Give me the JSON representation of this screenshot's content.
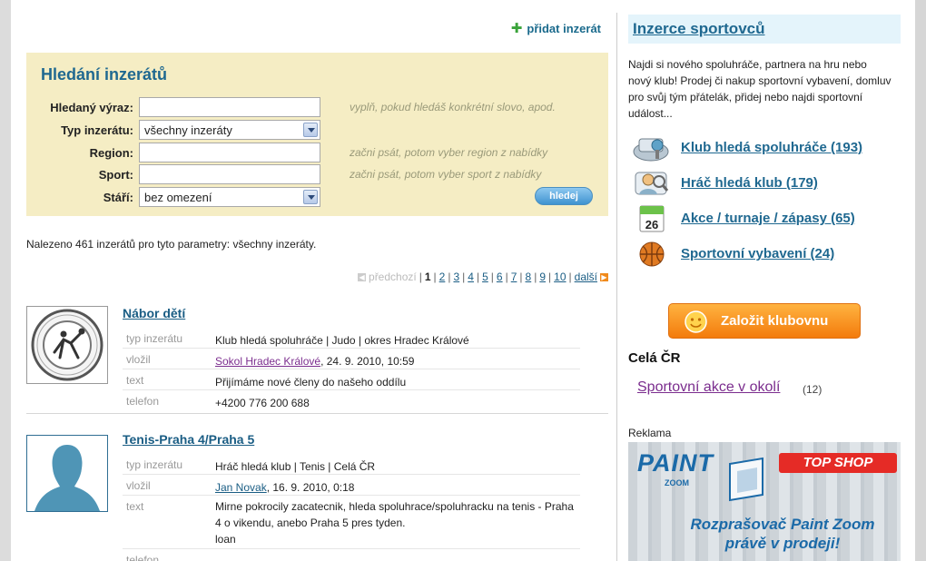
{
  "add_listing": "přidat inzerát",
  "search": {
    "title": "Hledání inzerátů",
    "fields": [
      {
        "label": "Hledaný výraz:",
        "value": "",
        "hint": "vyplň, pokud hledáš konkrétní slovo, apod."
      },
      {
        "label": "Typ inzerátu:",
        "value": "všechny inzeráty",
        "hint": ""
      },
      {
        "label": "Region:",
        "value": "",
        "hint": "začni psát, potom vyber region z nabídky"
      },
      {
        "label": "Sport:",
        "value": "",
        "hint": "začni psát, potom vyber sport z nabídky"
      },
      {
        "label": "Stáří:",
        "value": "bez omezení",
        "hint": ""
      }
    ],
    "button": "hledej"
  },
  "result_text": "Nalezeno 461 inzerátů pro tyto parametry: všechny inzeráty.",
  "pagination": {
    "prev": "předchozí",
    "current": "1",
    "pages": [
      "2",
      "3",
      "4",
      "5",
      "6",
      "7",
      "8",
      "9",
      "10"
    ],
    "next": "další",
    "separator": "|"
  },
  "listings": [
    {
      "title": "Nábor dětí",
      "rows": [
        {
          "key": "typ inzerátu",
          "value": "Klub hledá spoluhráče | Judo | okres Hradec Králové"
        },
        {
          "key": "vložil",
          "author": "Sokol Hradec Králové",
          "date": ", 24. 9. 2010, 10:59"
        },
        {
          "key": "text",
          "value": "Přijímáme nové členy do našeho oddílu"
        },
        {
          "key": "telefon",
          "value": "+4200 776 200 688"
        }
      ]
    },
    {
      "title": "Tenis-Praha 4/Praha 5",
      "rows": [
        {
          "key": "typ inzerátu",
          "value": "Hráč hledá klub | Tenis | Celá ČR"
        },
        {
          "key": "vložil",
          "author": "Jan Novak",
          "date": ", 16. 9. 2010, 0:18"
        },
        {
          "key": "text",
          "value": "Mirne pokrocily zacatecnik, hleda spoluhrace/spoluhracku na tenis - Praha 4 o vikendu, anebo Praha 5 pres tyden.",
          "value2": "loan"
        },
        {
          "key": "telefon",
          "value": ""
        }
      ]
    }
  ],
  "sidebar": {
    "title": "Inzerce sportovců",
    "intro": "Najdi si nového spoluhráče, partnera na hru nebo nový klub! Prodej či nakup sportovní vybavení, domluv pro svůj tým přátelák, přidej nebo najdi sportovní událost...",
    "categories": [
      {
        "label": "Klub hledá spoluhráče (193)",
        "icon": "team-icon"
      },
      {
        "label": "Hráč hledá klub (179)",
        "icon": "player-icon"
      },
      {
        "label": "Akce / turnaje / zápasy (65)",
        "icon": "calendar-icon",
        "calendar_day": "26"
      },
      {
        "label": "Sportovní vybavení (24)",
        "icon": "basketball-icon"
      }
    ],
    "club_button": "Založit klubovnu",
    "region": "Celá ČR",
    "region_link": "Sportovní akce v okolí",
    "region_count": "(12)",
    "ad_label": "Reklama",
    "ad": {
      "logo": "PAINT",
      "logo_sub": "ZOOM",
      "shop": "TOP SHOP",
      "text1": "Rozprašovač Paint Zoom",
      "text2": "právě v prodeji!"
    }
  },
  "colors": {
    "accent": "#1f6890",
    "search_bg": "#f5edc4",
    "button_orange": "#f37b0c",
    "visited": "#7b2d8e"
  }
}
